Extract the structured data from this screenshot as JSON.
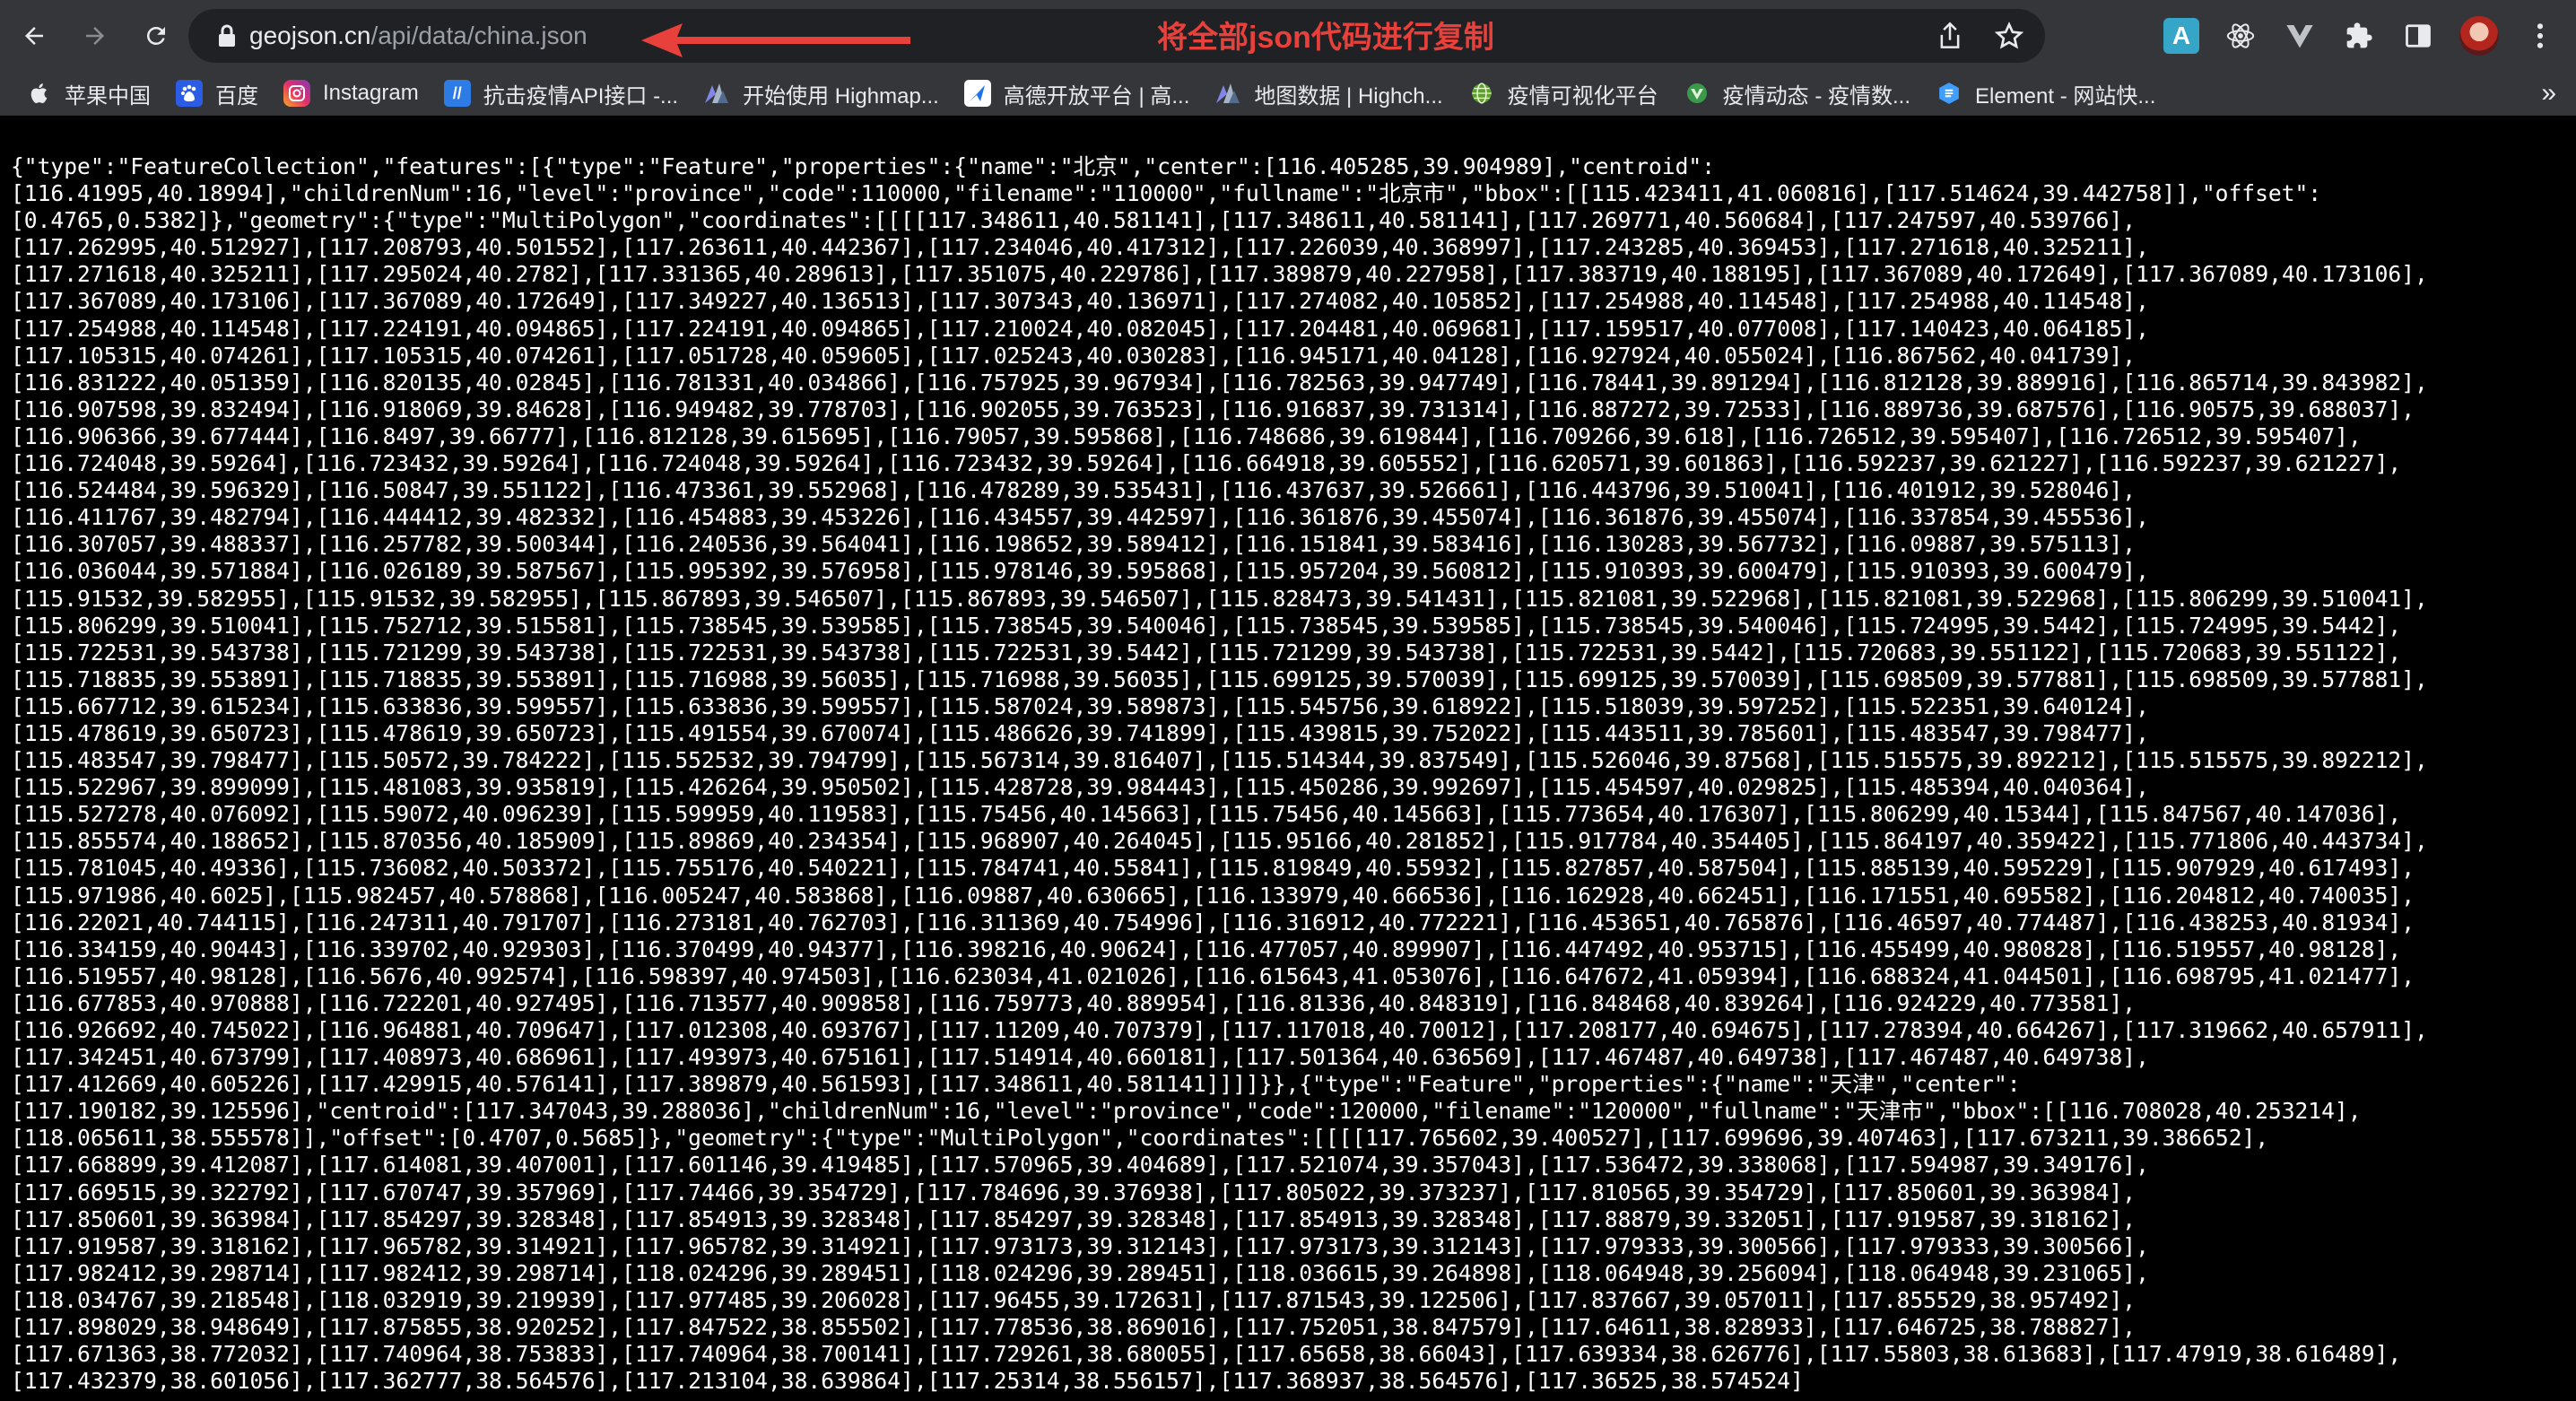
{
  "browser": {
    "url_domain": "geojson.cn",
    "url_path": "/api/data/china.json",
    "annotation": "将全部json代码进行复制",
    "colors": {
      "toolbar": "#35363a",
      "omnibox": "#202124",
      "annotation": "#e8403a"
    },
    "nav_icons": [
      "back-arrow-icon",
      "forward-arrow-icon",
      "reload-icon"
    ],
    "omnibox_icons": [
      "share-icon",
      "bookmark-star-icon"
    ],
    "extension_icons": [
      "a-extension-icon",
      "react-devtools-icon",
      "vuetify-extension-icon",
      "puzzle-extensions-icon",
      "side-panel-icon",
      "profile-avatar",
      "more-menu-icon"
    ]
  },
  "bookmarks": [
    {
      "label": "苹果中国",
      "icon": "apple-icon"
    },
    {
      "label": "百度",
      "icon": "baidu-paw-icon"
    },
    {
      "label": "Instagram",
      "icon": "instagram-icon"
    },
    {
      "label": "抗击疫情API接口 -...",
      "icon": "api-doc-icon"
    },
    {
      "label": "开始使用 Highmap...",
      "icon": "highcharts-icon"
    },
    {
      "label": "高德开放平台 | 高...",
      "icon": "amap-icon"
    },
    {
      "label": "地图数据 | Highch...",
      "icon": "highcharts-icon"
    },
    {
      "label": "疫情可视化平台",
      "icon": "globe-icon"
    },
    {
      "label": "疫情动态 - 疫情数...",
      "icon": "vue-icon"
    },
    {
      "label": "Element - 网站快...",
      "icon": "element-icon"
    }
  ],
  "bookmarks_overflow": "»",
  "json_text": "{\"type\":\"FeatureCollection\",\"features\":[{\"type\":\"Feature\",\"properties\":{\"name\":\"北京\",\"center\":[116.405285,39.904989],\"centroid\":\n[116.41995,40.18994],\"childrenNum\":16,\"level\":\"province\",\"code\":110000,\"filename\":\"110000\",\"fullname\":\"北京市\",\"bbox\":[[115.423411,41.060816],[117.514624,39.442758]],\"offset\":\n[0.4765,0.5382]},\"geometry\":{\"type\":\"MultiPolygon\",\"coordinates\":[[[[117.348611,40.581141],[117.348611,40.581141],[117.269771,40.560684],[117.247597,40.539766],\n[117.262995,40.512927],[117.208793,40.501552],[117.263611,40.442367],[117.234046,40.417312],[117.226039,40.368997],[117.243285,40.369453],[117.271618,40.325211],\n[117.271618,40.325211],[117.295024,40.2782],[117.331365,40.289613],[117.351075,40.229786],[117.389879,40.227958],[117.383719,40.188195],[117.367089,40.172649],[117.367089,40.173106],\n[117.367089,40.173106],[117.367089,40.172649],[117.349227,40.136513],[117.307343,40.136971],[117.274082,40.105852],[117.254988,40.114548],[117.254988,40.114548],\n[117.254988,40.114548],[117.224191,40.094865],[117.224191,40.094865],[117.210024,40.082045],[117.204481,40.069681],[117.159517,40.077008],[117.140423,40.064185],\n[117.105315,40.074261],[117.105315,40.074261],[117.051728,40.059605],[117.025243,40.030283],[116.945171,40.04128],[116.927924,40.055024],[116.867562,40.041739],\n[116.831222,40.051359],[116.820135,40.02845],[116.781331,40.034866],[116.757925,39.967934],[116.782563,39.947749],[116.78441,39.891294],[116.812128,39.889916],[116.865714,39.843982],\n[116.907598,39.832494],[116.918069,39.84628],[116.949482,39.778703],[116.902055,39.763523],[116.916837,39.731314],[116.887272,39.72533],[116.889736,39.687576],[116.90575,39.688037],\n[116.906366,39.677444],[116.8497,39.66777],[116.812128,39.615695],[116.79057,39.595868],[116.748686,39.619844],[116.709266,39.618],[116.726512,39.595407],[116.726512,39.595407],\n[116.724048,39.59264],[116.723432,39.59264],[116.724048,39.59264],[116.723432,39.59264],[116.664918,39.605552],[116.620571,39.601863],[116.592237,39.621227],[116.592237,39.621227],\n[116.524484,39.596329],[116.50847,39.551122],[116.473361,39.552968],[116.478289,39.535431],[116.437637,39.526661],[116.443796,39.510041],[116.401912,39.528046],\n[116.411767,39.482794],[116.444412,39.482332],[116.454883,39.453226],[116.434557,39.442597],[116.361876,39.455074],[116.361876,39.455074],[116.337854,39.455536],\n[116.307057,39.488337],[116.257782,39.500344],[116.240536,39.564041],[116.198652,39.589412],[116.151841,39.583416],[116.130283,39.567732],[116.09887,39.575113],\n[116.036044,39.571884],[116.026189,39.587567],[115.995392,39.576958],[115.978146,39.595868],[115.957204,39.560812],[115.910393,39.600479],[115.910393,39.600479],\n[115.91532,39.582955],[115.91532,39.582955],[115.867893,39.546507],[115.867893,39.546507],[115.828473,39.541431],[115.821081,39.522968],[115.821081,39.522968],[115.806299,39.510041],\n[115.806299,39.510041],[115.752712,39.515581],[115.738545,39.539585],[115.738545,39.540046],[115.738545,39.539585],[115.738545,39.540046],[115.724995,39.5442],[115.724995,39.5442],\n[115.722531,39.543738],[115.721299,39.543738],[115.722531,39.543738],[115.722531,39.5442],[115.721299,39.543738],[115.722531,39.5442],[115.720683,39.551122],[115.720683,39.551122],\n[115.718835,39.553891],[115.718835,39.553891],[115.716988,39.56035],[115.716988,39.56035],[115.699125,39.570039],[115.699125,39.570039],[115.698509,39.577881],[115.698509,39.577881],\n[115.667712,39.615234],[115.633836,39.599557],[115.633836,39.599557],[115.587024,39.589873],[115.545756,39.618922],[115.518039,39.597252],[115.522351,39.640124],\n[115.478619,39.650723],[115.478619,39.650723],[115.491554,39.670074],[115.486626,39.741899],[115.439815,39.752022],[115.443511,39.785601],[115.483547,39.798477],\n[115.483547,39.798477],[115.50572,39.784222],[115.552532,39.794799],[115.567314,39.816407],[115.514344,39.837549],[115.526046,39.87568],[115.515575,39.892212],[115.515575,39.892212],\n[115.522967,39.899099],[115.481083,39.935819],[115.426264,39.950502],[115.428728,39.984443],[115.450286,39.992697],[115.454597,40.029825],[115.485394,40.040364],\n[115.527278,40.076092],[115.59072,40.096239],[115.599959,40.119583],[115.75456,40.145663],[115.75456,40.145663],[115.773654,40.176307],[115.806299,40.15344],[115.847567,40.147036],\n[115.855574,40.188652],[115.870356,40.185909],[115.89869,40.234354],[115.968907,40.264045],[115.95166,40.281852],[115.917784,40.354405],[115.864197,40.359422],[115.771806,40.443734],\n[115.781045,40.49336],[115.736082,40.503372],[115.755176,40.540221],[115.784741,40.55841],[115.819849,40.55932],[115.827857,40.587504],[115.885139,40.595229],[115.907929,40.617493],\n[115.971986,40.6025],[115.982457,40.578868],[116.005247,40.583868],[116.09887,40.630665],[116.133979,40.666536],[116.162928,40.662451],[116.171551,40.695582],[116.204812,40.740035],\n[116.22021,40.744115],[116.247311,40.791707],[116.273181,40.762703],[116.311369,40.754996],[116.316912,40.772221],[116.453651,40.765876],[116.46597,40.774487],[116.438253,40.81934],\n[116.334159,40.90443],[116.339702,40.929303],[116.370499,40.94377],[116.398216,40.90624],[116.477057,40.899907],[116.447492,40.953715],[116.455499,40.980828],[116.519557,40.98128],\n[116.519557,40.98128],[116.5676,40.992574],[116.598397,40.974503],[116.623034,41.021026],[116.615643,41.053076],[116.647672,41.059394],[116.688324,41.044501],[116.698795,41.021477],\n[116.677853,40.970888],[116.722201,40.927495],[116.713577,40.909858],[116.759773,40.889954],[116.81336,40.848319],[116.848468,40.839264],[116.924229,40.773581],\n[116.926692,40.745022],[116.964881,40.709647],[117.012308,40.693767],[117.11209,40.707379],[117.117018,40.70012],[117.208177,40.694675],[117.278394,40.664267],[117.319662,40.657911],\n[117.342451,40.673799],[117.408973,40.686961],[117.493973,40.675161],[117.514914,40.660181],[117.501364,40.636569],[117.467487,40.649738],[117.467487,40.649738],\n[117.412669,40.605226],[117.429915,40.576141],[117.389879,40.561593],[117.348611,40.581141]]]]}},{\"type\":\"Feature\",\"properties\":{\"name\":\"天津\",\"center\":\n[117.190182,39.125596],\"centroid\":[117.347043,39.288036],\"childrenNum\":16,\"level\":\"province\",\"code\":120000,\"filename\":\"120000\",\"fullname\":\"天津市\",\"bbox\":[[116.708028,40.253214],\n[118.065611,38.555578]],\"offset\":[0.4707,0.5685]},\"geometry\":{\"type\":\"MultiPolygon\",\"coordinates\":[[[[117.765602,39.400527],[117.699696,39.407463],[117.673211,39.386652],\n[117.668899,39.412087],[117.614081,39.407001],[117.601146,39.419485],[117.570965,39.404689],[117.521074,39.357043],[117.536472,39.338068],[117.594987,39.349176],\n[117.669515,39.322792],[117.670747,39.357969],[117.74466,39.354729],[117.784696,39.376938],[117.805022,39.373237],[117.810565,39.354729],[117.850601,39.363984],\n[117.850601,39.363984],[117.854297,39.328348],[117.854913,39.328348],[117.854297,39.328348],[117.854913,39.328348],[117.88879,39.332051],[117.919587,39.318162],\n[117.919587,39.318162],[117.965782,39.314921],[117.965782,39.314921],[117.973173,39.312143],[117.973173,39.312143],[117.979333,39.300566],[117.979333,39.300566],\n[117.982412,39.298714],[117.982412,39.298714],[118.024296,39.289451],[118.024296,39.289451],[118.036615,39.264898],[118.064948,39.256094],[118.064948,39.231065],\n[118.034767,39.218548],[118.032919,39.219939],[117.977485,39.206028],[117.96455,39.172631],[117.871543,39.122506],[117.837667,39.057011],[117.855529,38.957492],\n[117.898029,38.948649],[117.875855,38.920252],[117.847522,38.855502],[117.778536,38.869016],[117.752051,38.847579],[117.64611,38.828933],[117.646725,38.788827],\n[117.671363,38.772032],[117.740964,38.753833],[117.740964,38.700141],[117.729261,38.680055],[117.65658,38.66043],[117.639334,38.626776],[117.55803,38.613683],[117.47919,38.616489],\n[117.432379,38.601056],[117.362777,38.564576],[117.213104,38.639864],[117.25314,38.556157],[117.368937,38.564576],[117.36525,38.574524]"
}
